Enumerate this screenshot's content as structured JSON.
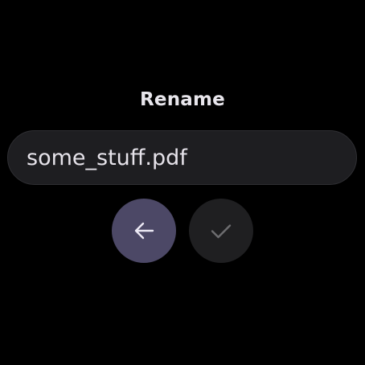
{
  "dialog": {
    "title": "Rename"
  },
  "filename_field": {
    "value": "some_stuff.pdf"
  },
  "actions": {
    "back_icon": "arrow-back-icon",
    "confirm_icon": "checkmark-icon",
    "back_color": "#4c4866",
    "confirm_color": "#1f1f21"
  },
  "colors": {
    "background": "#000000",
    "text": "#e8e6ec",
    "field_background": "#1e1e21"
  }
}
